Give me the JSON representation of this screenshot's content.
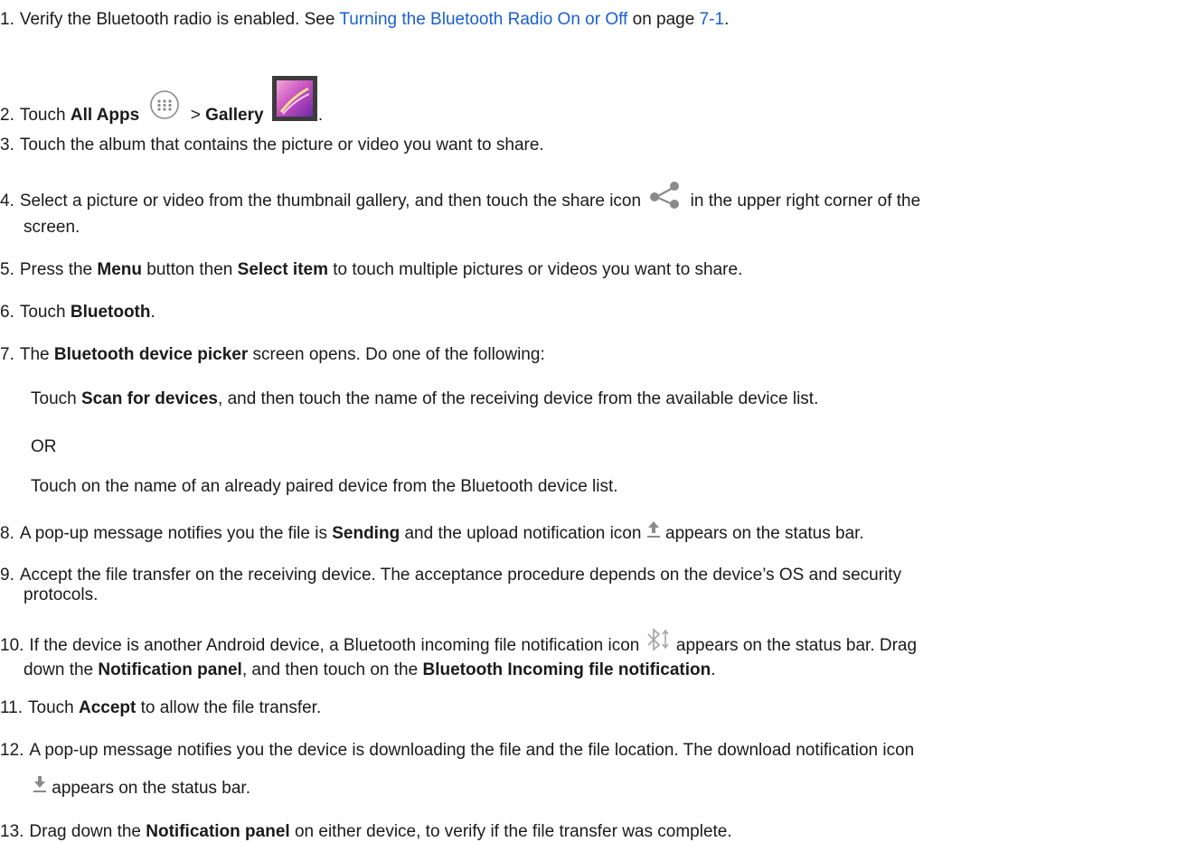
{
  "steps": {
    "s1": {
      "num": "1.",
      "t1": "Verify the Bluetooth radio is enabled. See ",
      "link1": "Turning the Bluetooth Radio On or Off",
      "t2": " on page ",
      "link2": "7-1",
      "t3": "."
    },
    "s2": {
      "num": "2.",
      "t1": "Touch ",
      "b1": "All Apps",
      "t2": " > ",
      "b2": "Gallery",
      "t3": "."
    },
    "s3": {
      "num": "3.",
      "t1": "Touch the album that contains the picture or video you want to share."
    },
    "s4": {
      "num": "4.",
      "t1": "Select a picture or video from the thumbnail gallery, and then touch the share icon ",
      "t2": " in the upper right corner of the",
      "t3": "screen."
    },
    "s5": {
      "num": "5.",
      "t1": "Press the ",
      "b1": "Menu",
      "t2": " button then ",
      "b2": "Select item",
      "t3": " to touch multiple pictures or videos you want to share."
    },
    "s6": {
      "num": "6.",
      "t1": "Touch ",
      "b1": "Bluetooth",
      "t2": "."
    },
    "s7": {
      "num": "7.",
      "t1": "The ",
      "b1": "Bluetooth device picker",
      "t2": " screen opens. Do one of the following:",
      "opt1_t1": "Touch ",
      "opt1_b1": "Scan for devices",
      "opt1_t2": ", and then touch the name of the receiving device from the available device list.",
      "or": "OR",
      "opt2": "Touch on the name of an already paired device from the Bluetooth device list."
    },
    "s8": {
      "num": "8.",
      "t1": "A pop-up message notifies you the file is ",
      "b1": "Sending",
      "t2": " and the upload notification icon ",
      "t3": " appears on the status bar."
    },
    "s9": {
      "num": "9.",
      "t1": "Accept the file transfer on the receiving device. The acceptance procedure depends on the device’s OS and security",
      "t2": "protocols."
    },
    "s10": {
      "num": "10.",
      "t1": "If the device is another Android device, a Bluetooth incoming file notification icon ",
      "t2": " appears on the status bar. Drag",
      "t3": "down the ",
      "b1": "Notification panel",
      "t4": ", and then touch on the ",
      "b2": "Bluetooth Incoming file notification",
      "t5": "."
    },
    "s11": {
      "num": "11.",
      "t1": "Touch ",
      "b1": "Accept",
      "t2": " to allow the file transfer."
    },
    "s12": {
      "num": "12.",
      "t1": "A pop-up message notifies you the device is downloading the file and the file location. The download notification icon",
      "t2": " appears on the status bar."
    },
    "s13": {
      "num": "13.",
      "t1": "Drag down the ",
      "b1": "Notification panel",
      "t2": " on either device, to verify if the file transfer was complete."
    }
  },
  "icons": {
    "all_apps": "all-apps-icon",
    "gallery": "gallery-app-icon",
    "share": "share-icon",
    "upload": "upload-notification-icon",
    "bluetooth_incoming": "bluetooth-incoming-icon",
    "download": "download-notification-icon"
  },
  "colors": {
    "link": "#1a5fd0",
    "icon_gray": "#8a8a8a"
  }
}
